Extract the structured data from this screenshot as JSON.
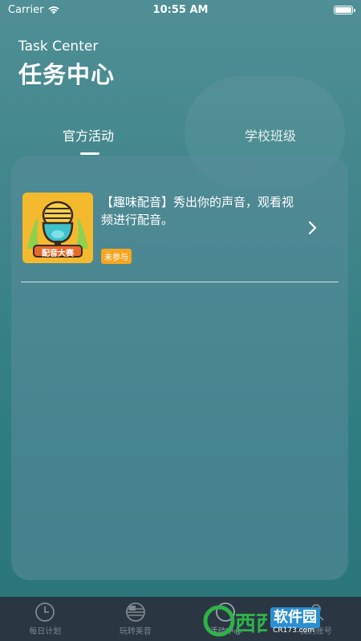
{
  "status_bar": {
    "carrier": "Carrier",
    "time": "10:55 AM"
  },
  "header": {
    "title_en": "Task Center",
    "title_cn": "任务中心"
  },
  "tabs": [
    {
      "label": "官方活动",
      "active": true
    },
    {
      "label": "学校班级",
      "active": false
    }
  ],
  "activities": [
    {
      "thumbnail_text": "配音大赛",
      "title": "【趣味配音】秀出你的声音，观看视频进行配音。",
      "status": "未参与"
    }
  ],
  "bottom_nav": [
    {
      "label": "每日计划",
      "icon": "clock-icon"
    },
    {
      "label": "玩转美音",
      "icon": "flag-icon"
    },
    {
      "label": "活动中心",
      "icon": "activity-icon"
    },
    {
      "label": "我的账号",
      "icon": "user-icon"
    }
  ],
  "watermark": {
    "brand_cn": "软件园",
    "domain": "CR173.com"
  },
  "colors": {
    "accent": "#f5a623",
    "thumb_bg": "#f5b92e",
    "tabbar_bg": "#2a3742"
  }
}
